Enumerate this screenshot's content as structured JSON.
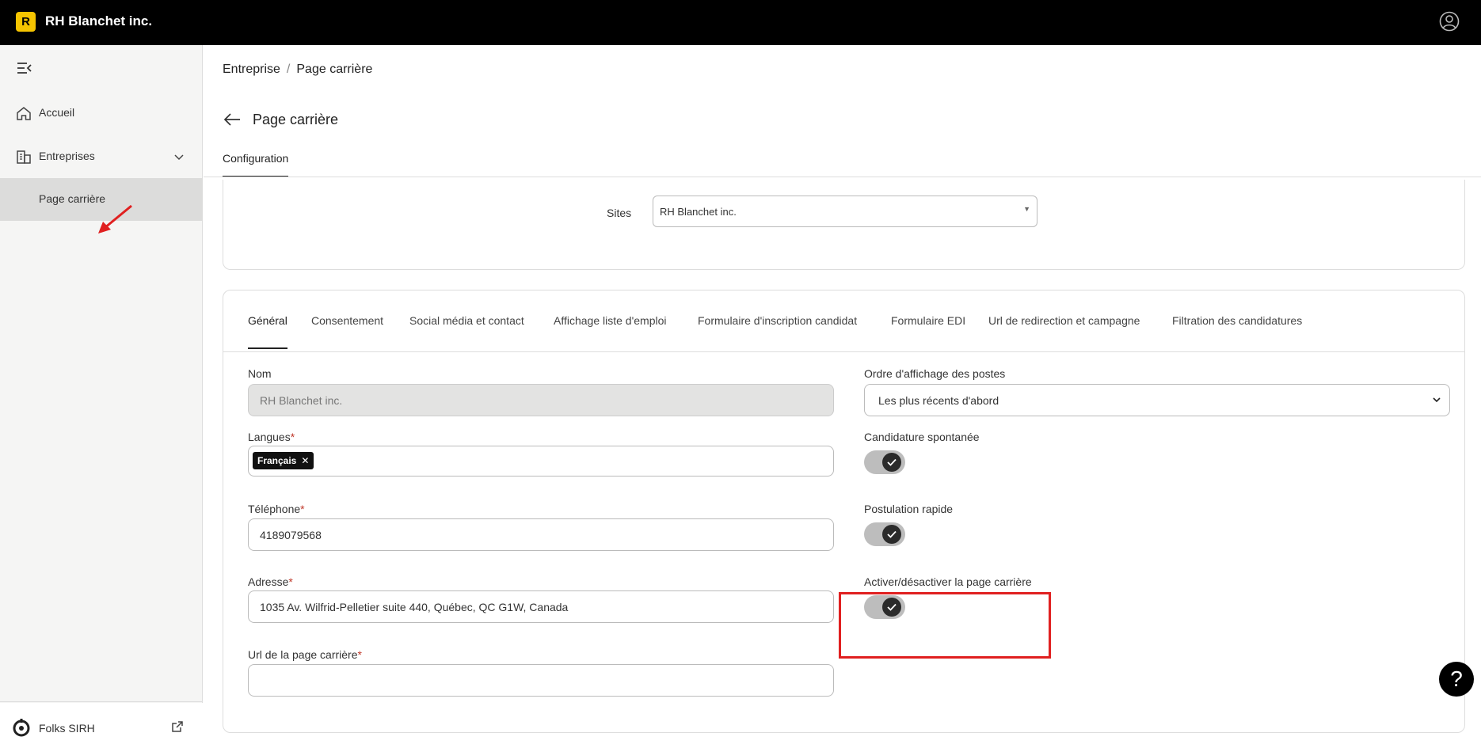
{
  "app": {
    "logo_letter": "R",
    "brand": "RH Blanchet inc."
  },
  "sidebar": {
    "items": [
      {
        "label": "Accueil",
        "icon": "home-icon"
      },
      {
        "label": "Entreprises",
        "icon": "building-icon"
      },
      {
        "label": "Page carrière",
        "icon": ""
      }
    ],
    "footer_label": "Folks SIRH"
  },
  "breadcrumb": {
    "part1": "Entreprise",
    "separator": "/",
    "part2": "Page carrière"
  },
  "page": {
    "title": "Page carrière",
    "tab": "Configuration"
  },
  "sites": {
    "label": "Sites",
    "value": "RH Blanchet inc."
  },
  "subtabs": [
    "Général",
    "Consentement",
    "Social média et contact",
    "Affichage liste d'emploi",
    "Formulaire d'inscription candidat",
    "Formulaire EDI",
    "Url de redirection et campagne",
    "Filtration des candidatures"
  ],
  "form": {
    "nom": {
      "label": "Nom",
      "value": "RH Blanchet inc."
    },
    "langues": {
      "label": "Langues",
      "chip": "Français",
      "chip_remove": "✕"
    },
    "telephone": {
      "label": "Téléphone",
      "value": "4189079568"
    },
    "adresse": {
      "label": "Adresse",
      "value": "1035 Av. Wilfrid-Pelletier suite 440, Québec, QC G1W, Canada"
    },
    "url": {
      "label": "Url de la page carrière"
    },
    "ordre": {
      "label": "Ordre d'affichage des postes",
      "value": "Les plus récents d'abord"
    },
    "candidature": {
      "label": "Candidature spontanée",
      "enabled": true
    },
    "postulation": {
      "label": "Postulation rapide",
      "enabled": true
    },
    "activer": {
      "label": "Activer/désactiver la page carrière",
      "enabled": true
    },
    "required_mark": "*"
  },
  "help": {
    "label": "?"
  },
  "colors": {
    "accent_yellow": "#f5c400",
    "annotation_red": "#e02020"
  }
}
